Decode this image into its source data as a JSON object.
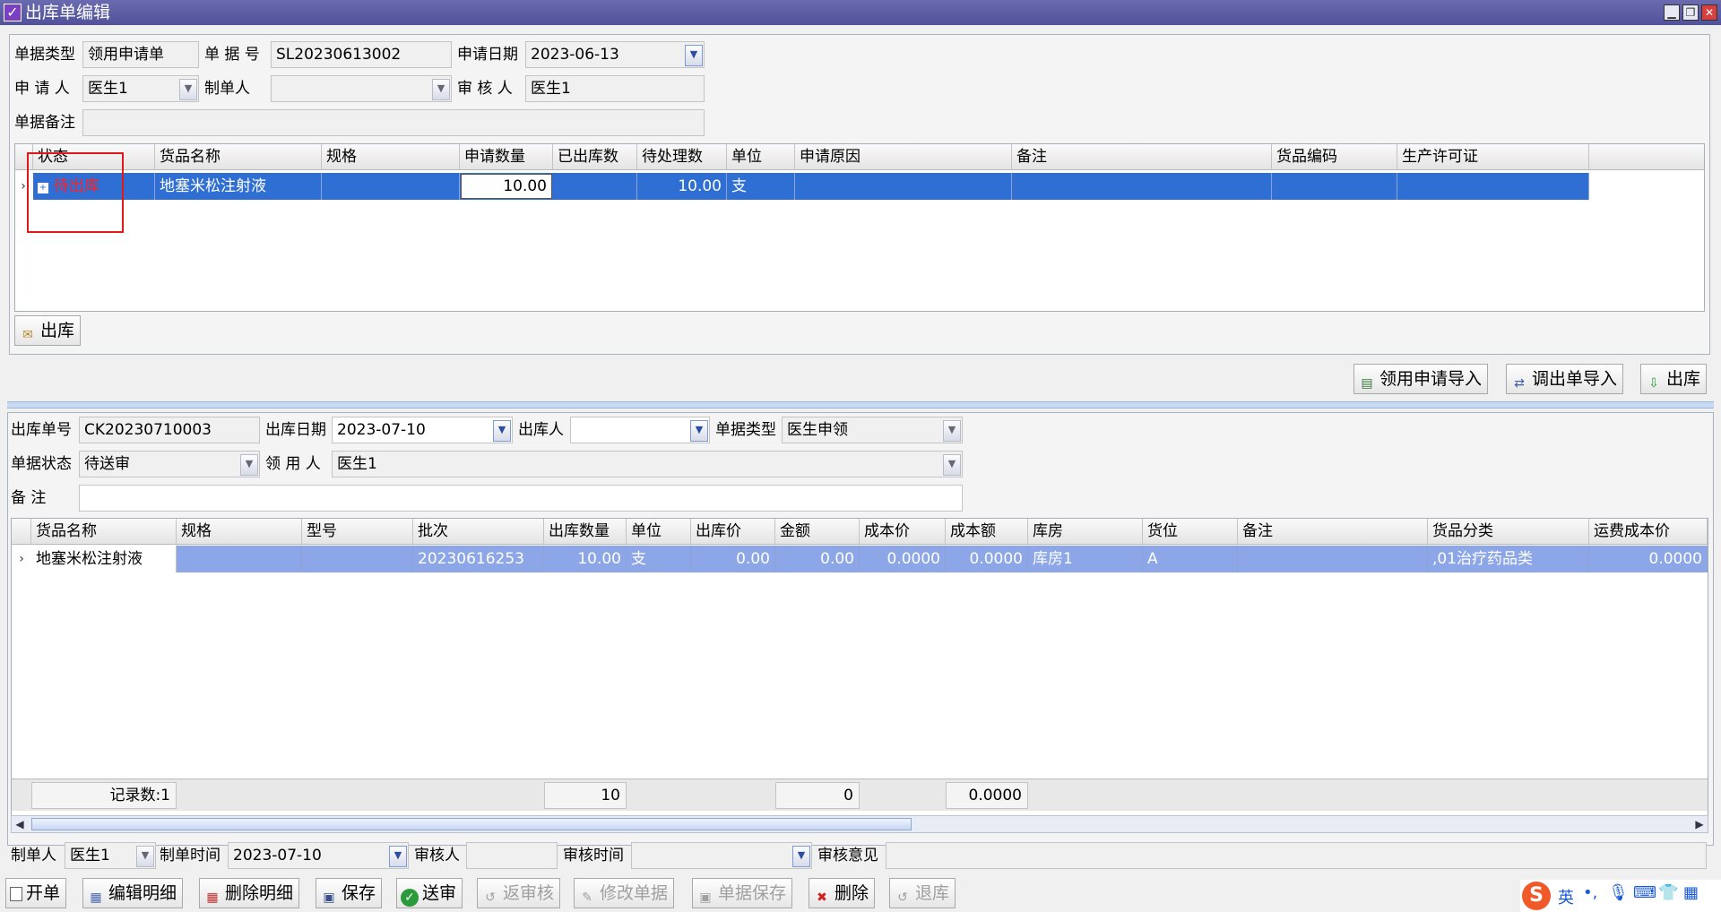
{
  "window": {
    "title": "出库单编辑"
  },
  "request": {
    "labels": {
      "doc_type": "单据类型",
      "doc_no": "单 据 号",
      "apply_date": "申请日期",
      "applicant": "申 请 人",
      "maker": "制单人",
      "reviewer": "审 核 人",
      "remark": "单据备注"
    },
    "values": {
      "doc_type": "领用申请单",
      "doc_no": "SL20230613002",
      "apply_date": "2023-06-13",
      "applicant": "医生1",
      "maker": "",
      "reviewer": "医生1",
      "remark": ""
    }
  },
  "request_grid": {
    "columns": [
      "状态",
      "货品名称",
      "规格",
      "申请数量",
      "已出库数",
      "待处理数",
      "单位",
      "申请原因",
      "备注",
      "货品编码",
      "生产许可证"
    ],
    "rows": [
      {
        "status": "待出库",
        "name": "地塞米松注射液",
        "spec": "",
        "apply_qty": "10.00",
        "out_qty": "",
        "pending_qty": "10.00",
        "unit": "支",
        "reason": "",
        "remark": "",
        "code": "",
        "license": ""
      }
    ]
  },
  "request_out_button": "出库",
  "import_buttons": {
    "apply_import": "领用申请导入",
    "transfer_import": "调出单导入",
    "out": "出库"
  },
  "outbound": {
    "labels": {
      "out_no": "出库单号",
      "out_date": "出库日期",
      "out_person": "出库人",
      "doc_type": "单据类型",
      "doc_status": "单据状态",
      "receiver": "领 用 人",
      "remark": "备    注"
    },
    "values": {
      "out_no": "CK20230710003",
      "out_date": "2023-07-10",
      "out_person": "",
      "doc_type": "医生申领",
      "doc_status": "待送审",
      "receiver": "医生1",
      "remark": ""
    }
  },
  "outbound_grid": {
    "columns": [
      "货品名称",
      "规格",
      "型号",
      "批次",
      "出库数量",
      "单位",
      "出库价",
      "金额",
      "成本价",
      "成本额",
      "库房",
      "货位",
      "备注",
      "货品分类",
      "运费成本价"
    ],
    "rows": [
      {
        "name": "地塞米松注射液",
        "spec": "",
        "model": "",
        "batch": "20230616253",
        "qty": "10.00",
        "unit": "支",
        "price": "0.00",
        "amount": "0.00",
        "cost_price": "0.0000",
        "cost_amount": "0.0000",
        "warehouse": "库房1",
        "location": "A",
        "remark": "",
        "category": ",01治疗药品类",
        "freight": "0.0000"
      }
    ],
    "footer": {
      "record_count": "记录数:1",
      "qty_total": "10",
      "amount_total": "0",
      "cost_total": "0.0000"
    }
  },
  "bottom_info": {
    "labels": {
      "maker": "制单人",
      "make_time": "制单时间",
      "reviewer": "审核人",
      "review_time": "审核时间",
      "review_opinion": "审核意见"
    },
    "values": {
      "maker": "医生1",
      "make_time": "2023-07-10",
      "reviewer": "",
      "review_time": "",
      "review_opinion": ""
    }
  },
  "toolbar": {
    "new": "开单",
    "edit_detail": "编辑明细",
    "delete_detail": "删除明细",
    "save": "保存",
    "submit": "送审",
    "return_review": "返审核",
    "modify_doc": "修改单据",
    "doc_save": "单据保存",
    "delete": "删除",
    "return_stock": "退库"
  },
  "ime": {
    "lang": "英"
  }
}
